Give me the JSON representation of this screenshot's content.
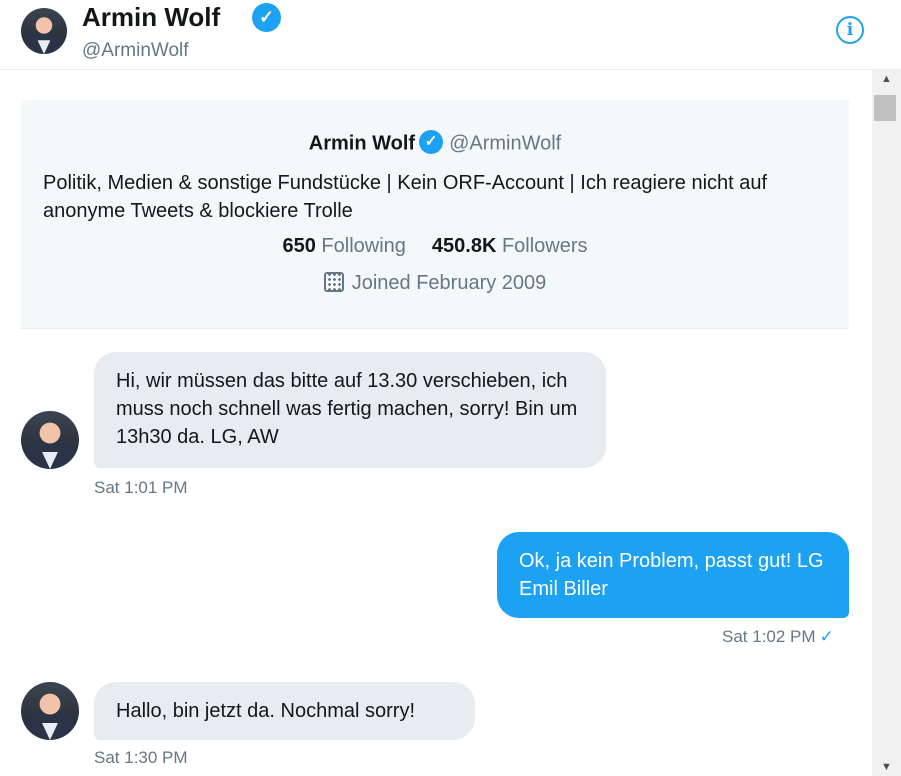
{
  "header": {
    "name": "Armin Wolf",
    "handle": "@ArminWolf",
    "verified_glyph": "✓",
    "info_glyph": "i"
  },
  "profile_card": {
    "name": "Armin Wolf",
    "handle": "@ArminWolf",
    "bio": "Politik, Medien & sonstige Fundstücke | Kein ORF-Account | Ich reagiere nicht auf anonyme Tweets & blockiere Trolle",
    "following_count": "650",
    "following_label": "Following",
    "followers_count": "450.8K",
    "followers_label": "Followers",
    "joined": "Joined February 2009"
  },
  "messages": [
    {
      "direction": "in",
      "text": "Hi, wir müssen das bitte auf 13.30 verschieben, ich muss noch schnell was fertig machen, sorry! Bin um 13h30 da. LG, AW",
      "time": "Sat 1:01 PM"
    },
    {
      "direction": "out",
      "text": "Ok, ja kein Problem, passt gut! LG Emil Biller",
      "time": "Sat 1:02 PM",
      "status_glyph": "✓"
    },
    {
      "direction": "in",
      "text": "Hallo, bin jetzt da. Nochmal sorry!",
      "time": "Sat 1:30 PM"
    }
  ],
  "colors": {
    "accent": "#1da1f2",
    "incoming_bubble": "#e6ecf0",
    "muted_text": "#657786",
    "card_background": "#f5f8fa"
  },
  "scrollbar": {
    "up_glyph": "▲",
    "down_glyph": "▼"
  }
}
